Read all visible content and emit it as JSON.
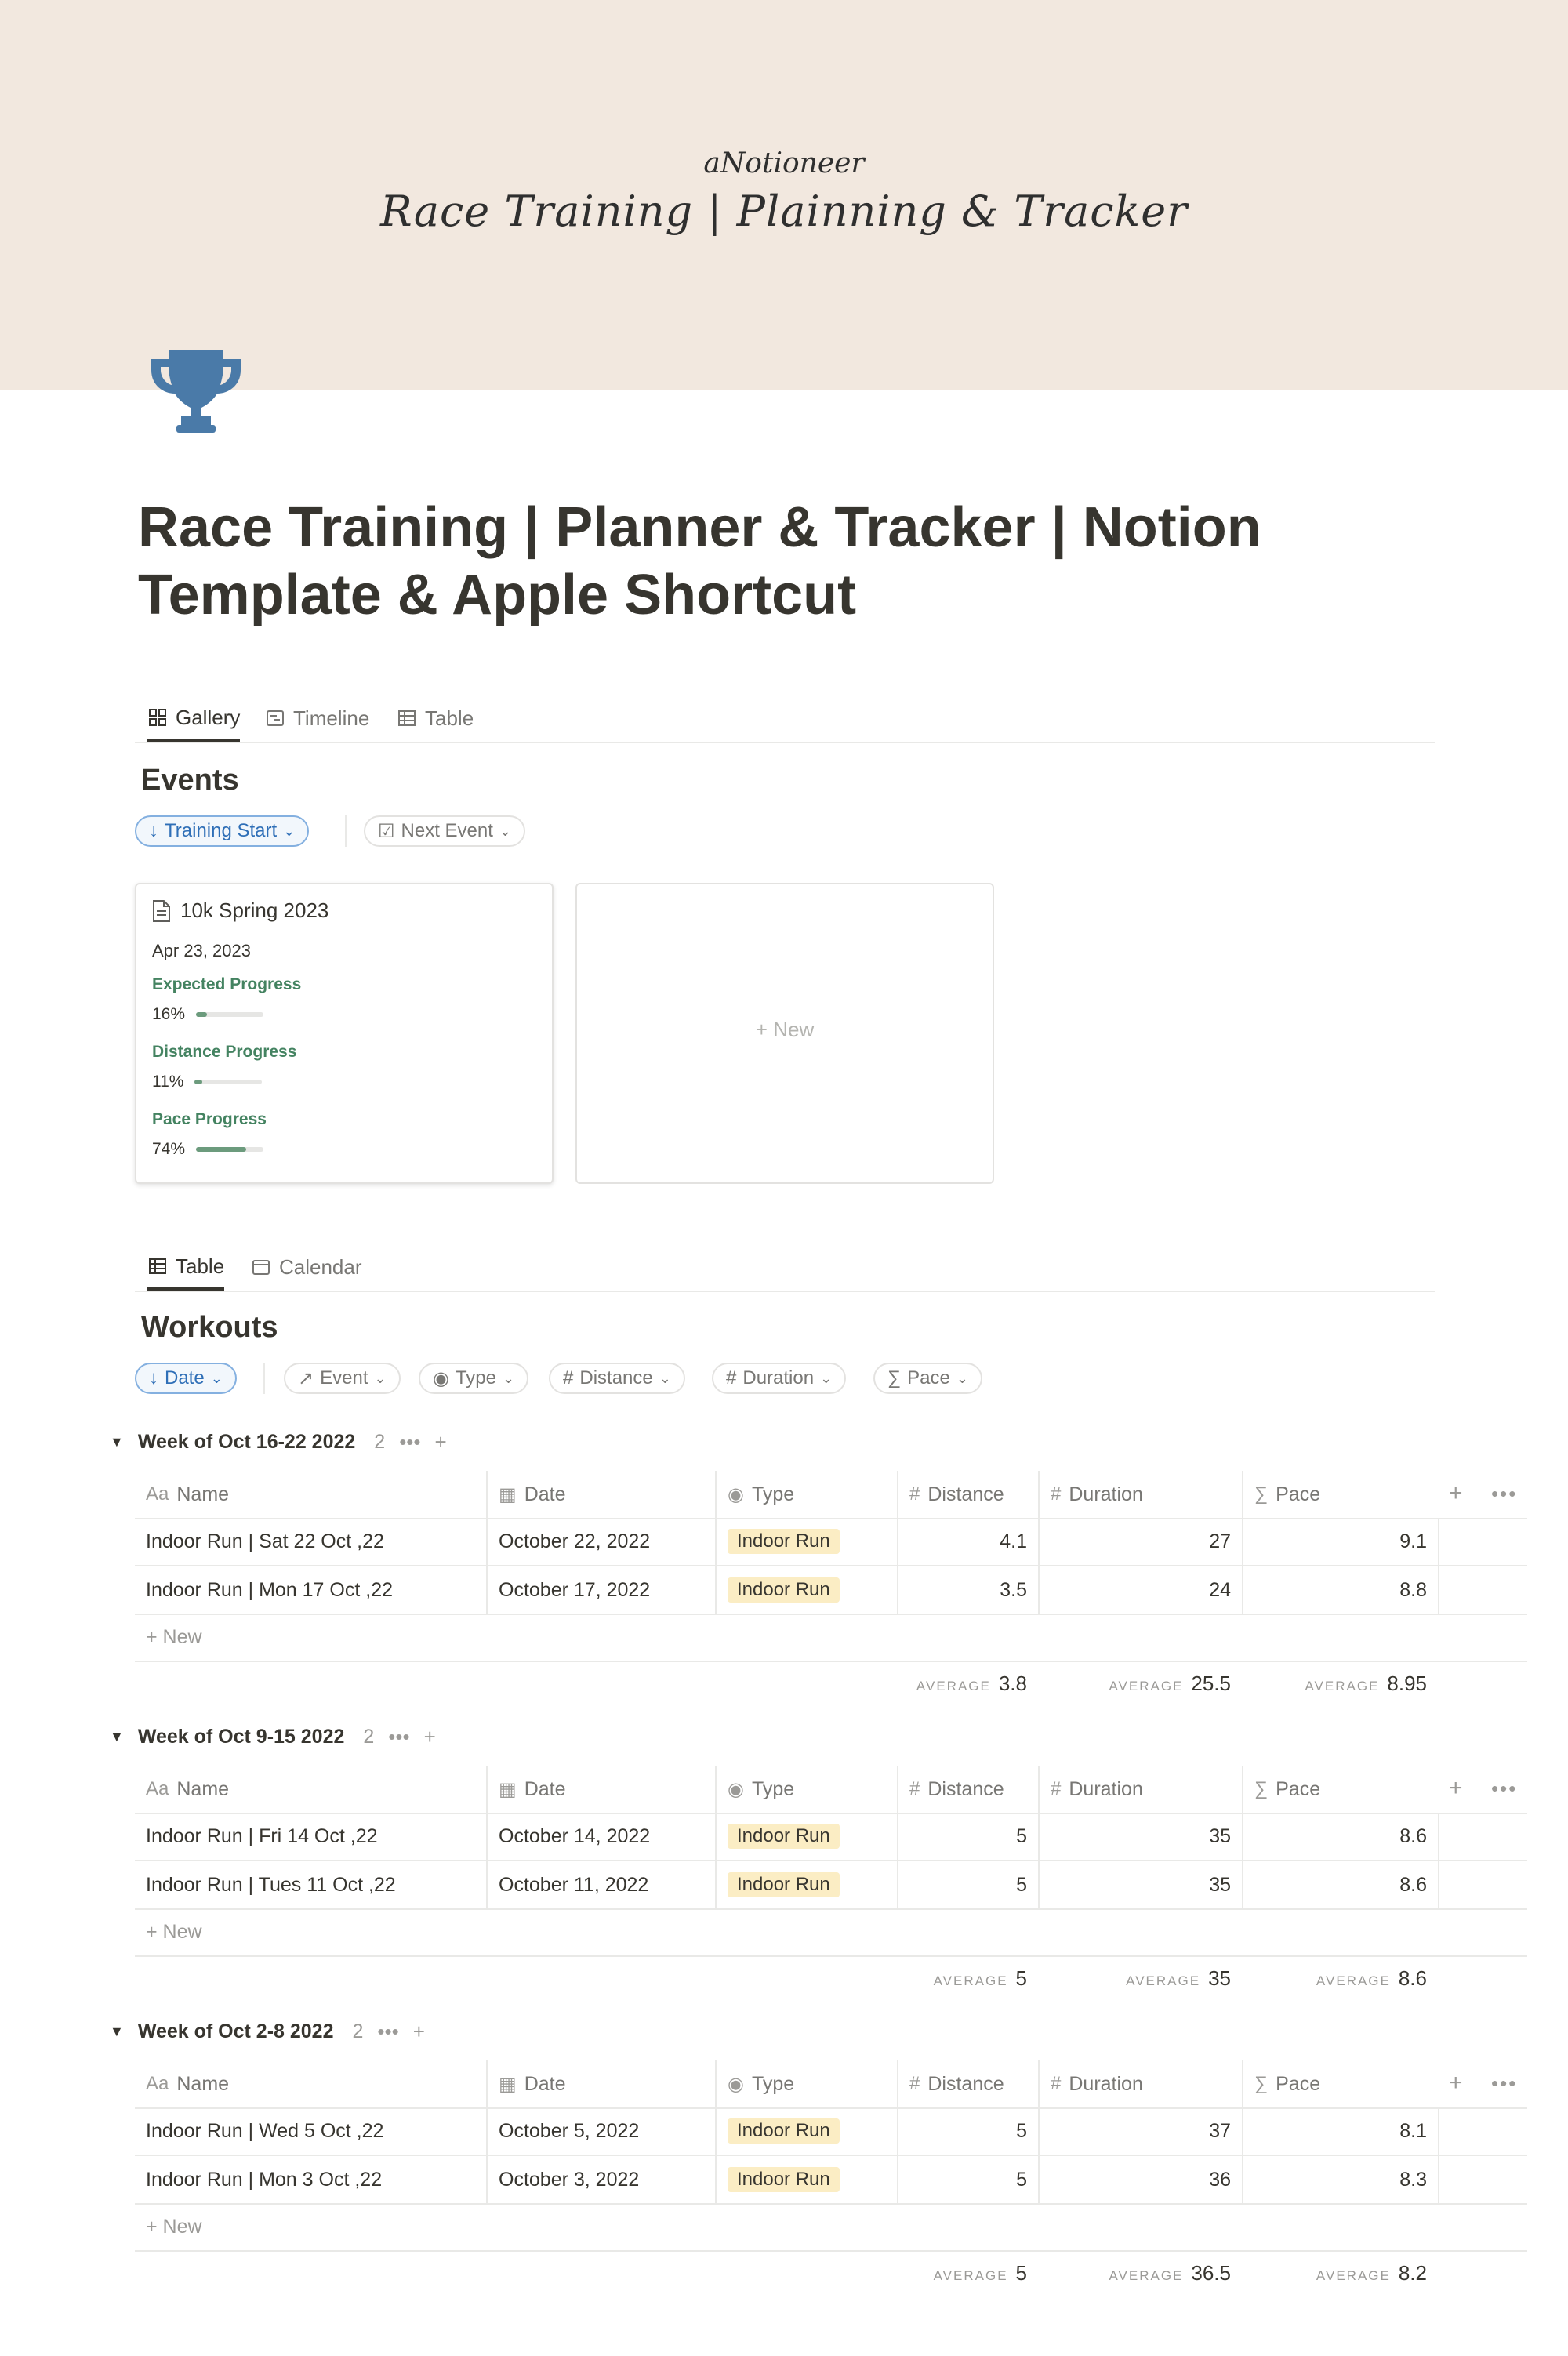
{
  "cover": {
    "brand": "aNotioneer",
    "title": "Race Training | Plainning & Tracker"
  },
  "page": {
    "title": "Race Training | Planner & Tracker | Notion Template & Apple Shortcut",
    "icon": "trophy-icon",
    "icon_color": "#4a7aa8"
  },
  "events_view": {
    "tabs": [
      "Gallery",
      "Timeline",
      "Table"
    ],
    "active_tab": "Gallery",
    "title": "Events",
    "filters": {
      "sort": "Training Start",
      "next": "Next Event"
    },
    "card": {
      "title": "10k Spring 2023",
      "date": "Apr 23, 2023",
      "props": [
        {
          "label": "Expected Progress",
          "value": "16%",
          "fraction": 0.16
        },
        {
          "label": "Distance Progress",
          "value": "11%",
          "fraction": 0.11
        },
        {
          "label": "Pace Progress",
          "value": "74%",
          "fraction": 0.74
        }
      ]
    },
    "new_card_label": "New"
  },
  "workouts_view": {
    "tabs": [
      "Table",
      "Calendar"
    ],
    "active_tab": "Table",
    "title": "Workouts",
    "filters": {
      "sort": "Date",
      "event": "Event",
      "type": "Type",
      "distance": "Distance",
      "duration": "Duration",
      "pace": "Pace"
    },
    "columns": {
      "name": "Name",
      "date": "Date",
      "type": "Type",
      "distance": "Distance",
      "duration": "Duration",
      "pace": "Pace"
    },
    "new_row_label": "New",
    "average_label": "AVERAGE",
    "groups": [
      {
        "title": "Week of Oct 16-22 2022",
        "count": "2",
        "rows": [
          {
            "name": "Indoor Run | Sat 22 Oct ,22",
            "date": "October 22, 2022",
            "type": "Indoor Run",
            "distance": "4.1",
            "duration": "27",
            "pace": "9.1"
          },
          {
            "name": "Indoor Run | Mon 17 Oct ,22",
            "date": "October 17, 2022",
            "type": "Indoor Run",
            "distance": "3.5",
            "duration": "24",
            "pace": "8.8"
          }
        ],
        "avg": {
          "distance": "3.8",
          "duration": "25.5",
          "pace": "8.95"
        }
      },
      {
        "title": "Week of Oct 9-15 2022",
        "count": "2",
        "rows": [
          {
            "name": "Indoor Run | Fri 14 Oct ,22",
            "date": "October 14, 2022",
            "type": "Indoor Run",
            "distance": "5",
            "duration": "35",
            "pace": "8.6"
          },
          {
            "name": "Indoor Run | Tues 11 Oct ,22",
            "date": "October 11, 2022",
            "type": "Indoor Run",
            "distance": "5",
            "duration": "35",
            "pace": "8.6"
          }
        ],
        "avg": {
          "distance": "5",
          "duration": "35",
          "pace": "8.6"
        }
      },
      {
        "title": "Week of Oct 2-8 2022",
        "count": "2",
        "rows": [
          {
            "name": "Indoor Run | Wed 5 Oct ,22",
            "date": "October 5, 2022",
            "type": "Indoor Run",
            "distance": "5",
            "duration": "37",
            "pace": "8.1"
          },
          {
            "name": "Indoor Run | Mon 3 Oct ,22",
            "date": "October 3, 2022",
            "type": "Indoor Run",
            "distance": "5",
            "duration": "36",
            "pace": "8.3"
          }
        ],
        "avg": {
          "distance": "5",
          "duration": "36.5",
          "pace": "8.2"
        }
      }
    ]
  }
}
